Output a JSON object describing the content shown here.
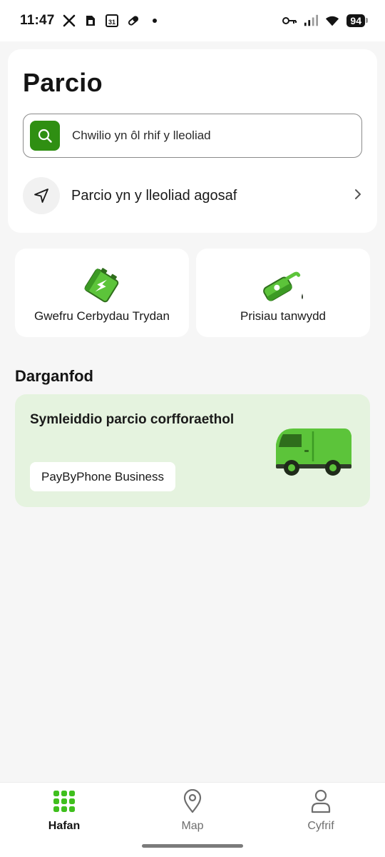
{
  "status_bar": {
    "time": "11:47",
    "battery": "94",
    "left_icons": [
      "x-icon",
      "sim-icon",
      "calendar-icon",
      "pill-icon",
      "dot-icon"
    ],
    "calendar_day": "31",
    "right_icons": [
      "key-icon",
      "signal-icon",
      "wifi-icon",
      "battery-icon"
    ]
  },
  "header": {
    "title": "Parcio"
  },
  "search": {
    "placeholder": "Chwilio yn ôl rhif y lleoliad",
    "icon": "search-icon"
  },
  "nearest": {
    "label": "Parcio yn y lleoliad agosaf",
    "icon": "navigation-arrow-icon"
  },
  "tiles": [
    {
      "label": "Gwefru Cerbydau Trydan",
      "icon": "ev-battery-icon"
    },
    {
      "label": "Prisiau tanwydd",
      "icon": "fuel-nozzle-icon"
    }
  ],
  "discover": {
    "title": "Darganfod",
    "promo": {
      "title": "Symleiddio parcio corfforaethol",
      "button": "PayByPhone Business",
      "icon": "van-icon"
    }
  },
  "bottom_nav": [
    {
      "label": "Hafan",
      "icon": "grid-icon",
      "active": true
    },
    {
      "label": "Map",
      "icon": "map-pin-icon",
      "active": false
    },
    {
      "label": "Cyfrif",
      "icon": "person-icon",
      "active": false
    }
  ],
  "colors": {
    "brand_green": "#2f8f12",
    "illustration_green": "#5cc43a",
    "promo_bg": "#e5f3df",
    "page_bg": "#f6f6f6"
  }
}
